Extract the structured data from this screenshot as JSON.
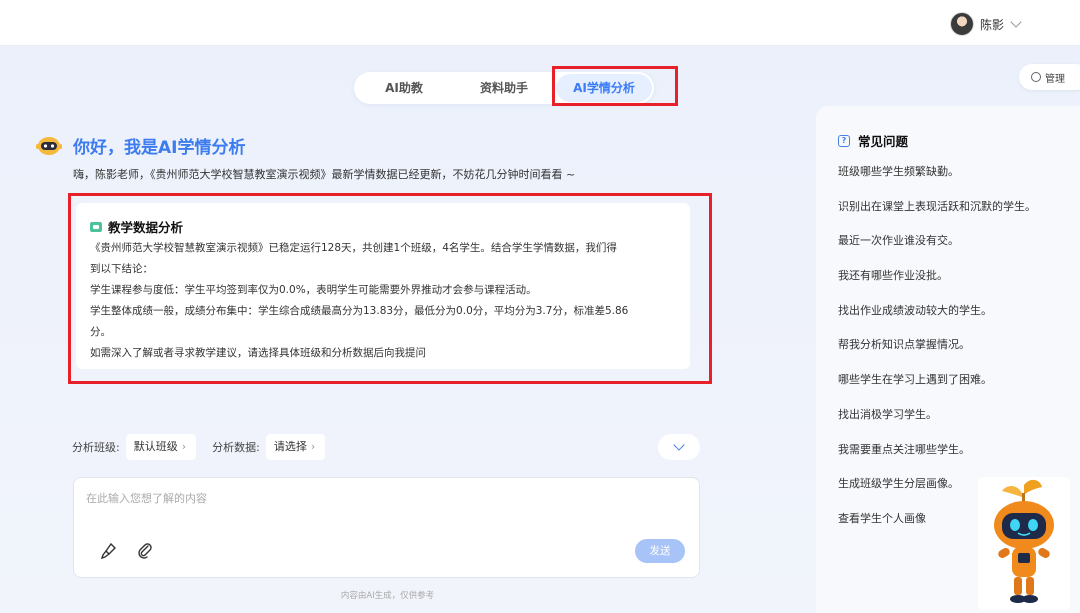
{
  "user": {
    "name": "陈影"
  },
  "tabs": [
    {
      "label": "AI助教"
    },
    {
      "label": "资料助手"
    },
    {
      "label": "AI学情分析"
    }
  ],
  "manage_label": "管理",
  "greeting": {
    "title": "你好，我是AI学情分析",
    "subtitle": "嗨，陈影老师，《贵州师范大学校智慧教室演示视频》最新学情数据已经更新，不妨花几分钟时间看看 ~"
  },
  "analysis": {
    "title": "教学数据分析",
    "lines": [
      "《贵州师范大学校智慧教室演示视频》已稳定运行128天，共创建1个班级，4名学生。结合学生学情数据，我们得",
      "到以下结论：",
      "学生课程参与度低：学生平均签到率仅为0.0%，表明学生可能需要外界推动才会参与课程活动。",
      "学生整体成绩一般，成绩分布集中：学生综合成绩最高分为13.83分，最低分为0.0分，平均分为3.7分，标准差5.86",
      "分。",
      "如需深入了解或者寻求教学建议，请选择具体班级和分析数据后向我提问"
    ]
  },
  "selectors": {
    "class_label": "分析班级:",
    "class_value": "默认班级",
    "data_label": "分析数据:",
    "data_value": "请选择",
    "arrow": "›"
  },
  "input": {
    "placeholder": "在此输入您想了解的内容",
    "send_label": "发送"
  },
  "footnote": "内容由AI生成，仅供参考",
  "faq": {
    "title": "常见问题",
    "items": [
      "班级哪些学生频繁缺勤。",
      "识别出在课堂上表现活跃和沉默的学生。",
      "最近一次作业谁没有交。",
      "我还有哪些作业没批。",
      "找出作业成绩波动较大的学生。",
      "帮我分析知识点掌握情况。",
      "哪些学生在学习上遇到了困难。",
      "找出消极学习学生。",
      "我需要重点关注哪些学生。",
      "生成班级学生分层画像。",
      "查看学生个人画像"
    ]
  },
  "colors": {
    "accent": "#3a7cf6",
    "highlight_box": "#e8202a",
    "send_disabled": "#a8c3f7"
  },
  "icons": {
    "brush": "brush-icon",
    "attach": "paperclip-icon",
    "faq": "question-icon",
    "manage": "gear-icon"
  }
}
